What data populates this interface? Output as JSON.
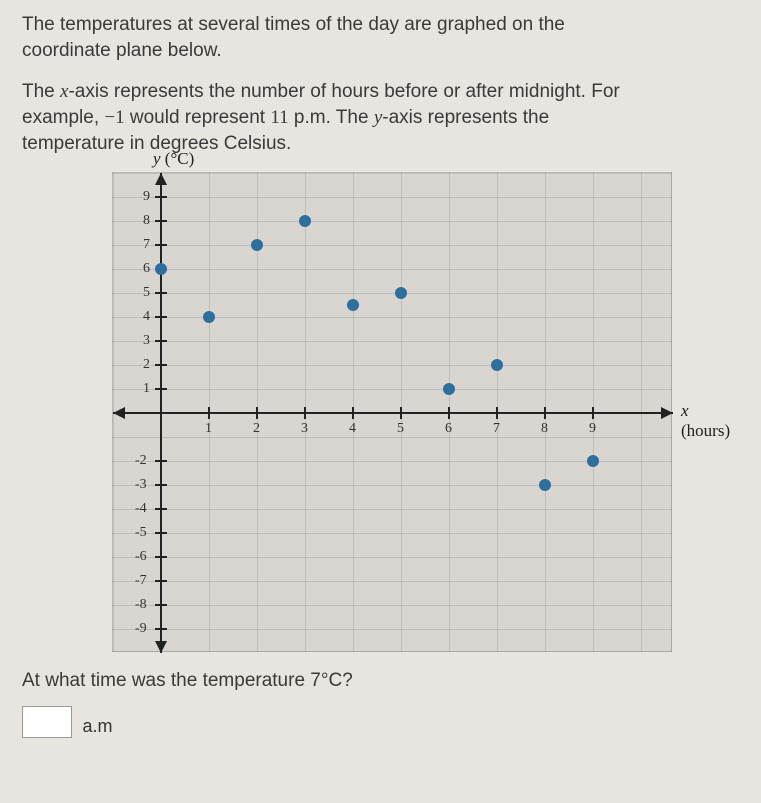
{
  "intro": {
    "line1a": "The temperatures at several times of the day are graphed on the",
    "line1b": "coordinate plane below.",
    "line2a_pre": "The ",
    "line2a_x": "x",
    "line2a_post": "-axis represents the number of hours before or after midnight. For",
    "line2b_pre": "example, ",
    "line2b_neg1": "−1",
    "line2b_mid": " would represent ",
    "line2b_11": "11",
    "line2b_pm": " p.m.",
    "line2b_post": " The ",
    "line2b_y": "y",
    "line2b_end": "-axis represents the",
    "line2c": "temperature in degrees Celsius."
  },
  "chart_data": {
    "type": "scatter",
    "ylabel": "y (°C)",
    "xlabel": "x (hours)",
    "x_ticks": [
      "1",
      "2",
      "3",
      "4",
      "5",
      "6",
      "7",
      "8",
      "9"
    ],
    "y_ticks_pos": [
      "1",
      "2",
      "3",
      "4",
      "5",
      "6",
      "7",
      "8",
      "9"
    ],
    "y_ticks_neg": [
      "-2",
      "-3",
      "-4",
      "-5",
      "-6",
      "-7",
      "-8",
      "-9"
    ],
    "xlim": [
      -1,
      10
    ],
    "ylim": [
      -10,
      10
    ],
    "series": [
      {
        "name": "temperature",
        "points": [
          {
            "x": 0,
            "y": 6
          },
          {
            "x": 1,
            "y": 4
          },
          {
            "x": 2,
            "y": 7
          },
          {
            "x": 3,
            "y": 8
          },
          {
            "x": 4,
            "y": 4.5
          },
          {
            "x": 5,
            "y": 5
          },
          {
            "x": 6,
            "y": 1
          },
          {
            "x": 7,
            "y": 2
          },
          {
            "x": 8,
            "y": -3
          },
          {
            "x": 9,
            "y": -2
          }
        ]
      }
    ]
  },
  "question": {
    "text_pre": "At what time was the temperature ",
    "value": "7°C",
    "text_post": "?"
  },
  "answer": {
    "value": "",
    "unit_fragment": "a.m"
  }
}
